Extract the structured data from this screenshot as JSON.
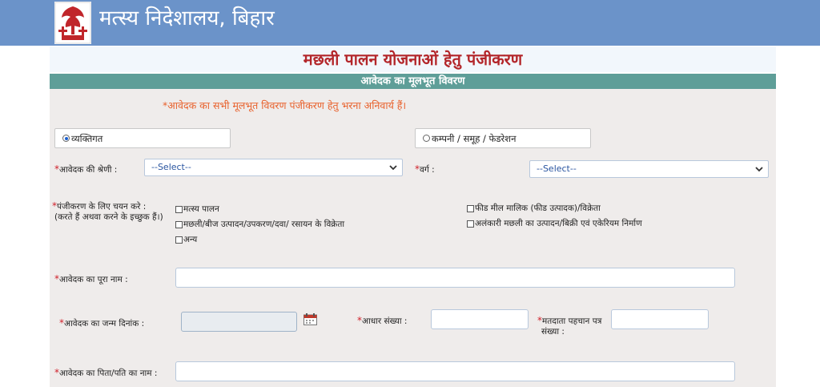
{
  "header": {
    "site_title": "मत्स्य निदेशालय, बिहार",
    "logo_icon": "bihar-emblem-icon",
    "background_color": "#6b93c9"
  },
  "page": {
    "title": "मछली पालन योजनाओं हेतु पंजीकरण",
    "section_title": "आवेदक का मूलभूत विवरण",
    "notice": "*आवेदक का सभी मूलभूत विवरण पंजीकरण हेतु भरना अनिवार्य हैं।"
  },
  "applicant_type": {
    "options": [
      {
        "label": "व्यक्तिगत",
        "selected": true
      },
      {
        "label": "कम्पनी / समूह / फेडरेशन",
        "selected": false
      }
    ]
  },
  "fields": {
    "category": {
      "label": "आवेदक की श्रेणी :",
      "value": "--Select--"
    },
    "class": {
      "label": "वर्ग :",
      "value": "--Select--"
    },
    "registration_choice": {
      "label_line1": "पंजीकरण के लिए चयन करे :",
      "label_line2": "(करते हैं अथवा करने के इच्छुक हैं।)",
      "options": [
        "मत्स्य पालन",
        "मछली/बीज उत्पादन/उपकरण/दवा/ रसायन के विक्रेता",
        "अन्य",
        "फीड मील मालिक (फीड उत्पादक)/विक्रेता",
        "अलंकारी मछली का उत्पादन/बिक्री एवं एकेरियम निर्माण"
      ]
    },
    "full_name": {
      "label": "आवेदक का पूरा नाम :",
      "value": ""
    },
    "dob": {
      "label": "आवेदक का जन्म दिनांक :",
      "value": ""
    },
    "aadhaar": {
      "label": "आधार संख्या :",
      "value": ""
    },
    "voter_id": {
      "label_line1": "मतदाता पहचान पत्र",
      "label_line2": "संख्या :",
      "value": ""
    },
    "father_name": {
      "label": "आवेदक का पिता/पति का नाम :",
      "value": ""
    }
  },
  "required_marker": "*",
  "colors": {
    "title_red": "#b3262a",
    "section_teal": "#5e9e98",
    "notice_orange": "#e8612c",
    "required_red": "#d0202a"
  }
}
